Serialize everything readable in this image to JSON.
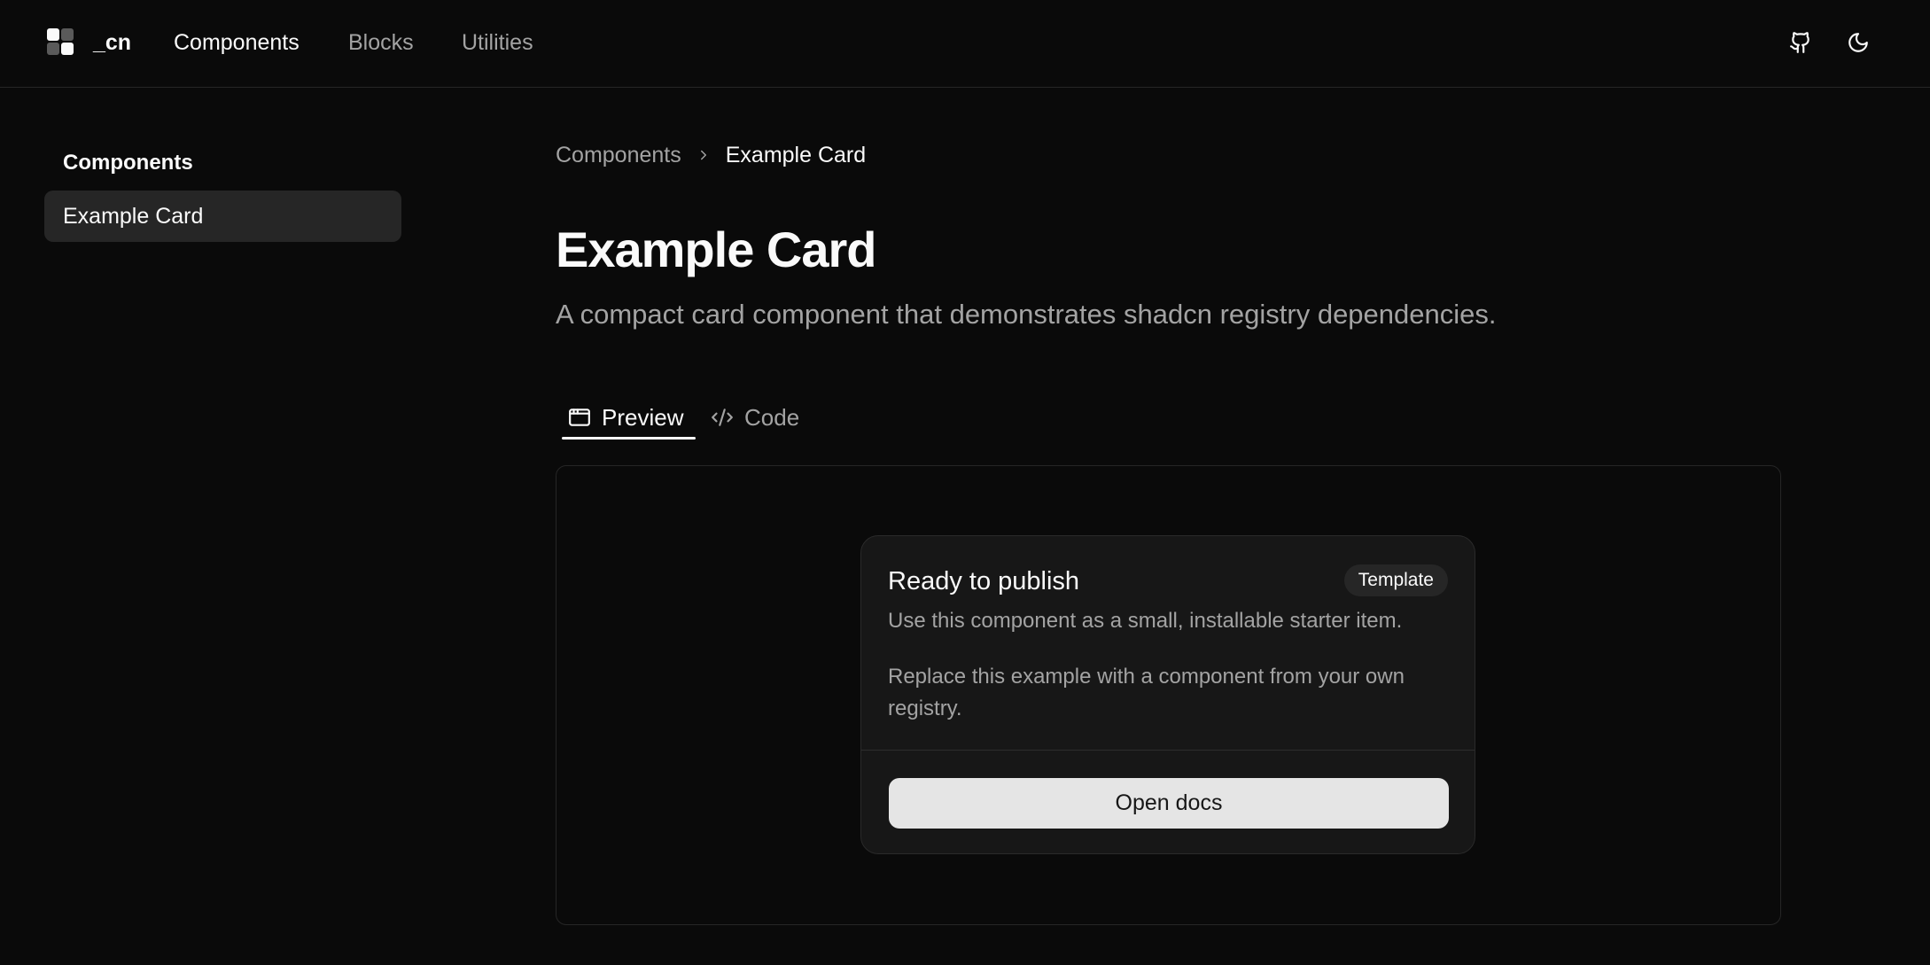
{
  "header": {
    "brand": "_cn",
    "nav": [
      {
        "label": "Components",
        "active": true
      },
      {
        "label": "Blocks",
        "active": false
      },
      {
        "label": "Utilities",
        "active": false
      }
    ],
    "icons": [
      "github-icon",
      "moon-icon"
    ]
  },
  "sidebar": {
    "heading": "Components",
    "items": [
      {
        "label": "Example Card",
        "selected": true
      }
    ]
  },
  "breadcrumb": {
    "parent": "Components",
    "current": "Example Card"
  },
  "page": {
    "title": "Example Card",
    "description": "A compact card component that demonstrates shadcn registry dependencies."
  },
  "tabs": [
    {
      "label": "Preview",
      "icon": "window-icon",
      "active": true
    },
    {
      "label": "Code",
      "icon": "code-icon",
      "active": false
    }
  ],
  "card": {
    "title": "Ready to publish",
    "badge": "Template",
    "description": "Use this component as a small, installable starter item.",
    "body": "Replace this example with a component from your own registry.",
    "button": "Open docs"
  },
  "colors": {
    "background": "#0a0a0a",
    "card": "#171717",
    "muted_text": "#a3a3a3",
    "foreground": "#fafafa",
    "border": "#262626"
  }
}
